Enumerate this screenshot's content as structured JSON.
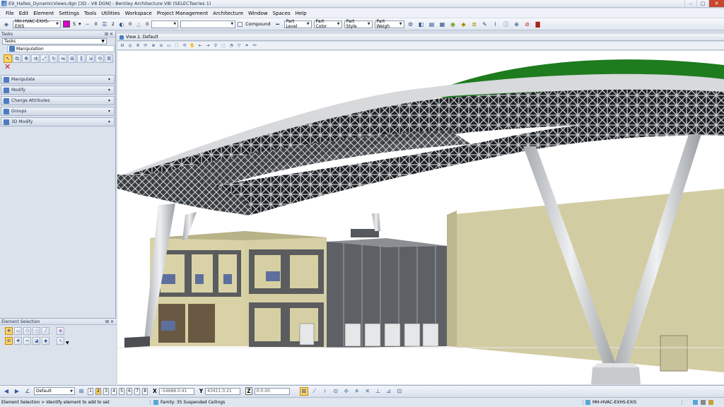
{
  "window": {
    "title": "E9_Halles_DynamicViews.dgn [3D - V8 DGN] - Bentley Architecture V8i (SELECTseries 1)",
    "minimize": "–",
    "maximize": "□",
    "close": "✕"
  },
  "menu": [
    "File",
    "Edit",
    "Element",
    "Settings",
    "Tools",
    "Utilities",
    "Workspace",
    "Project Management",
    "Architecture",
    "Window",
    "Spaces",
    "Help"
  ],
  "attributes": {
    "level": "MH-HVAC-EXHS-EXIS",
    "color_num": "5",
    "style_num": "0",
    "weight_num": "2",
    "transparency_num": "0",
    "priority_num": "0",
    "compound_label": "Compound",
    "part_level": "Part Level",
    "part_color": "Part Color",
    "part_style": "Part Style",
    "part_weight": "Part Weigh",
    "active_color": "#d800c8"
  },
  "tasks_panel": {
    "header": "Tasks",
    "pin": "⊞ ✕",
    "combo": "Tasks",
    "manipulation_title": "Manipulation",
    "sections": [
      "Manipulate",
      "Modify",
      "Change Attributes",
      "Groups",
      "3D Modify"
    ]
  },
  "element_selection": {
    "header": "Element Selection",
    "pin": "⊞ ✕"
  },
  "view": {
    "title": "View 2, Default"
  },
  "accudraw": {
    "nav_default": "Default",
    "views": [
      "1",
      "2",
      "3",
      "4",
      "5",
      "6",
      "7",
      "8"
    ],
    "active_view": "2",
    "x_label": "X",
    "x_value": "-54688.0:41",
    "y_label": "Y",
    "y_value": "43411.0:21",
    "z_label": "Z",
    "z_value": "0:0.00"
  },
  "status": {
    "prompt": "Element Selection > Identify element to add to set",
    "family": "Family: 35 Suspended Ceilings",
    "level": "MH-HVAC-EXHS-EXIS"
  }
}
